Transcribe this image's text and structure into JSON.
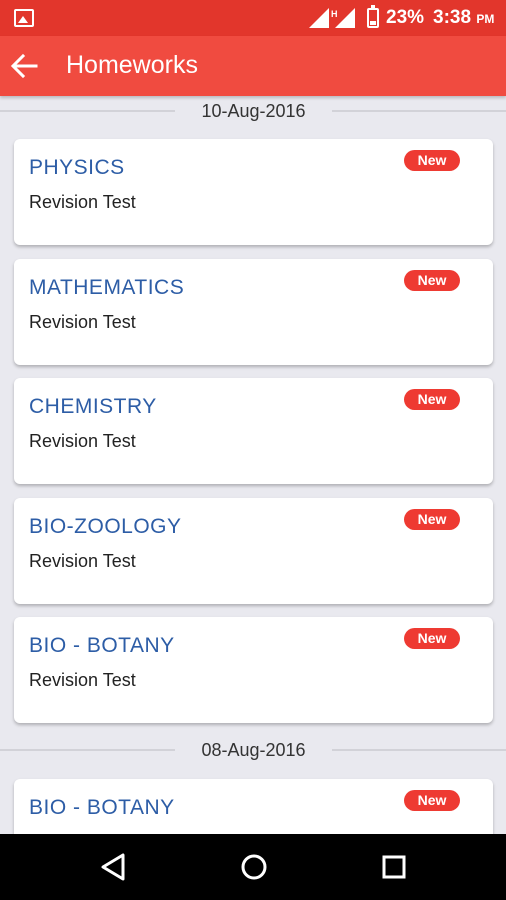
{
  "status_bar": {
    "battery_percent": "23%",
    "time": "3:38",
    "time_suffix": "PM",
    "icons": [
      "image-icon",
      "signal-icon",
      "h-signal-icon",
      "battery-icon"
    ]
  },
  "app_bar": {
    "title": "Homeworks",
    "back_icon": "arrow-left-icon"
  },
  "colors": {
    "status_bar": "#e2362c",
    "app_bar": "#f04b40",
    "subject_text": "#2d5da6",
    "badge": "#ee3a32",
    "background": "#e9e9ef"
  },
  "groups": [
    {
      "date": "10-Aug-2016",
      "items": [
        {
          "subject": "PHYSICS",
          "description": "Revision Test",
          "badge": "New"
        },
        {
          "subject": "MATHEMATICS",
          "description": "Revision Test",
          "badge": "New"
        },
        {
          "subject": "CHEMISTRY",
          "description": "Revision Test",
          "badge": "New"
        },
        {
          "subject": "BIO-ZOOLOGY",
          "description": "Revision Test",
          "badge": "New"
        },
        {
          "subject": "BIO - BOTANY",
          "description": "Revision Test",
          "badge": "New"
        }
      ]
    },
    {
      "date": "08-Aug-2016",
      "items": [
        {
          "subject": "BIO - BOTANY",
          "description": "",
          "badge": "New"
        }
      ]
    }
  ],
  "nav_bar": {
    "icons": [
      "back-triangle-icon",
      "home-circle-icon",
      "recents-square-icon"
    ]
  }
}
